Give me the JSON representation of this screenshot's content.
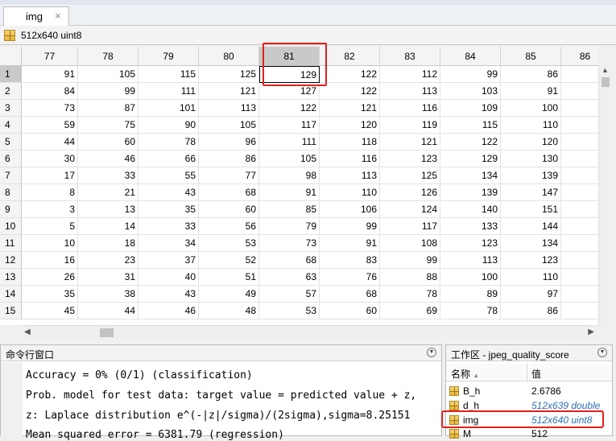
{
  "window": {
    "tab_label": "img",
    "tab_close": "×"
  },
  "info": {
    "size_class": "512x640 uint8"
  },
  "grid": {
    "columns": [
      "77",
      "78",
      "79",
      "80",
      "81",
      "82",
      "83",
      "84",
      "85",
      "86"
    ],
    "rows": [
      {
        "label": "1",
        "cells": [
          "91",
          "105",
          "115",
          "125",
          "129",
          "122",
          "112",
          "99",
          "86",
          ""
        ]
      },
      {
        "label": "2",
        "cells": [
          "84",
          "99",
          "111",
          "121",
          "127",
          "122",
          "113",
          "103",
          "91",
          ""
        ]
      },
      {
        "label": "3",
        "cells": [
          "73",
          "87",
          "101",
          "113",
          "122",
          "121",
          "116",
          "109",
          "100",
          ""
        ]
      },
      {
        "label": "4",
        "cells": [
          "59",
          "75",
          "90",
          "105",
          "117",
          "120",
          "119",
          "115",
          "110",
          ""
        ]
      },
      {
        "label": "5",
        "cells": [
          "44",
          "60",
          "78",
          "96",
          "111",
          "118",
          "121",
          "122",
          "120",
          ""
        ]
      },
      {
        "label": "6",
        "cells": [
          "30",
          "46",
          "66",
          "86",
          "105",
          "116",
          "123",
          "129",
          "130",
          ""
        ]
      },
      {
        "label": "7",
        "cells": [
          "17",
          "33",
          "55",
          "77",
          "98",
          "113",
          "125",
          "134",
          "139",
          ""
        ]
      },
      {
        "label": "8",
        "cells": [
          "8",
          "21",
          "43",
          "68",
          "91",
          "110",
          "126",
          "139",
          "147",
          ""
        ]
      },
      {
        "label": "9",
        "cells": [
          "3",
          "13",
          "35",
          "60",
          "85",
          "106",
          "124",
          "140",
          "151",
          ""
        ]
      },
      {
        "label": "10",
        "cells": [
          "5",
          "14",
          "33",
          "56",
          "79",
          "99",
          "117",
          "133",
          "144",
          ""
        ]
      },
      {
        "label": "11",
        "cells": [
          "10",
          "18",
          "34",
          "53",
          "73",
          "91",
          "108",
          "123",
          "134",
          ""
        ]
      },
      {
        "label": "12",
        "cells": [
          "16",
          "23",
          "37",
          "52",
          "68",
          "83",
          "99",
          "113",
          "123",
          ""
        ]
      },
      {
        "label": "13",
        "cells": [
          "26",
          "31",
          "40",
          "51",
          "63",
          "76",
          "88",
          "100",
          "110",
          ""
        ]
      },
      {
        "label": "14",
        "cells": [
          "35",
          "38",
          "43",
          "49",
          "57",
          "68",
          "78",
          "89",
          "97",
          ""
        ]
      },
      {
        "label": "15",
        "cells": [
          "45",
          "44",
          "46",
          "48",
          "53",
          "60",
          "69",
          "78",
          "86",
          ""
        ]
      }
    ]
  },
  "command_window": {
    "title": "命令行窗口",
    "lines": [
      "Accuracy = 0% (0/1) (classification)",
      "Prob. model for test data: target value = predicted value + z,",
      "z: Laplace distribution e^(-|z|/sigma)/(2sigma),sigma=8.25151",
      "Mean squared error = 6381.79 (regression)"
    ]
  },
  "workspace": {
    "title": "工作区 - jpeg_quality_score",
    "col_name": "名称",
    "col_value": "值",
    "vars": [
      {
        "name": "B_h",
        "value": "2.6786",
        "italic": false
      },
      {
        "name": "d_h",
        "value": "512x639 double",
        "italic": true
      },
      {
        "name": "img",
        "value": "512x640 uint8",
        "italic": true
      },
      {
        "name": "M",
        "value": "512",
        "italic": false
      }
    ]
  }
}
